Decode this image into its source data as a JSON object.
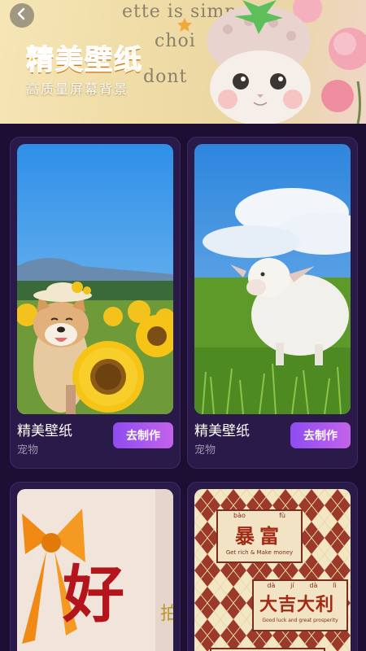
{
  "banner": {
    "title": "精美壁纸",
    "subtitle": "高质量屏幕背景",
    "script_lines": [
      "ette is simp",
      "choi",
      "dont"
    ]
  },
  "icons": {
    "back": "chevron-left-icon",
    "star": "star-icon"
  },
  "cards": [
    {
      "name": "精美壁纸",
      "category": "宠物",
      "button": "去制作",
      "image": "shiba-sunflower-photo"
    },
    {
      "name": "精美壁纸",
      "category": "宠物",
      "button": "去制作",
      "image": "lamb-on-grass-photo"
    },
    {
      "name": "",
      "category": "",
      "button": "",
      "image": "orange-bow-calligraphy",
      "art_text": "好"
    },
    {
      "name": "",
      "category": "",
      "button": "",
      "image": "argyle-lucky-wallpaper",
      "art": {
        "label1_chars": "暴富",
        "label1_pinyin": [
          "bào",
          "fù"
        ],
        "label1_en": "Get rich & Make money",
        "label2_chars": "大吉大利",
        "label2_pinyin": [
          "dà",
          "jí",
          "dà",
          "lì"
        ],
        "label2_en": "Good luck and great prosperity"
      }
    }
  ],
  "colors": {
    "background": "#1d0f33",
    "card": "#2a1a49",
    "button_start": "#8e4cf0",
    "button_end": "#c462ea",
    "title": "#ffb437",
    "secondary_text": "#9c92b0"
  }
}
